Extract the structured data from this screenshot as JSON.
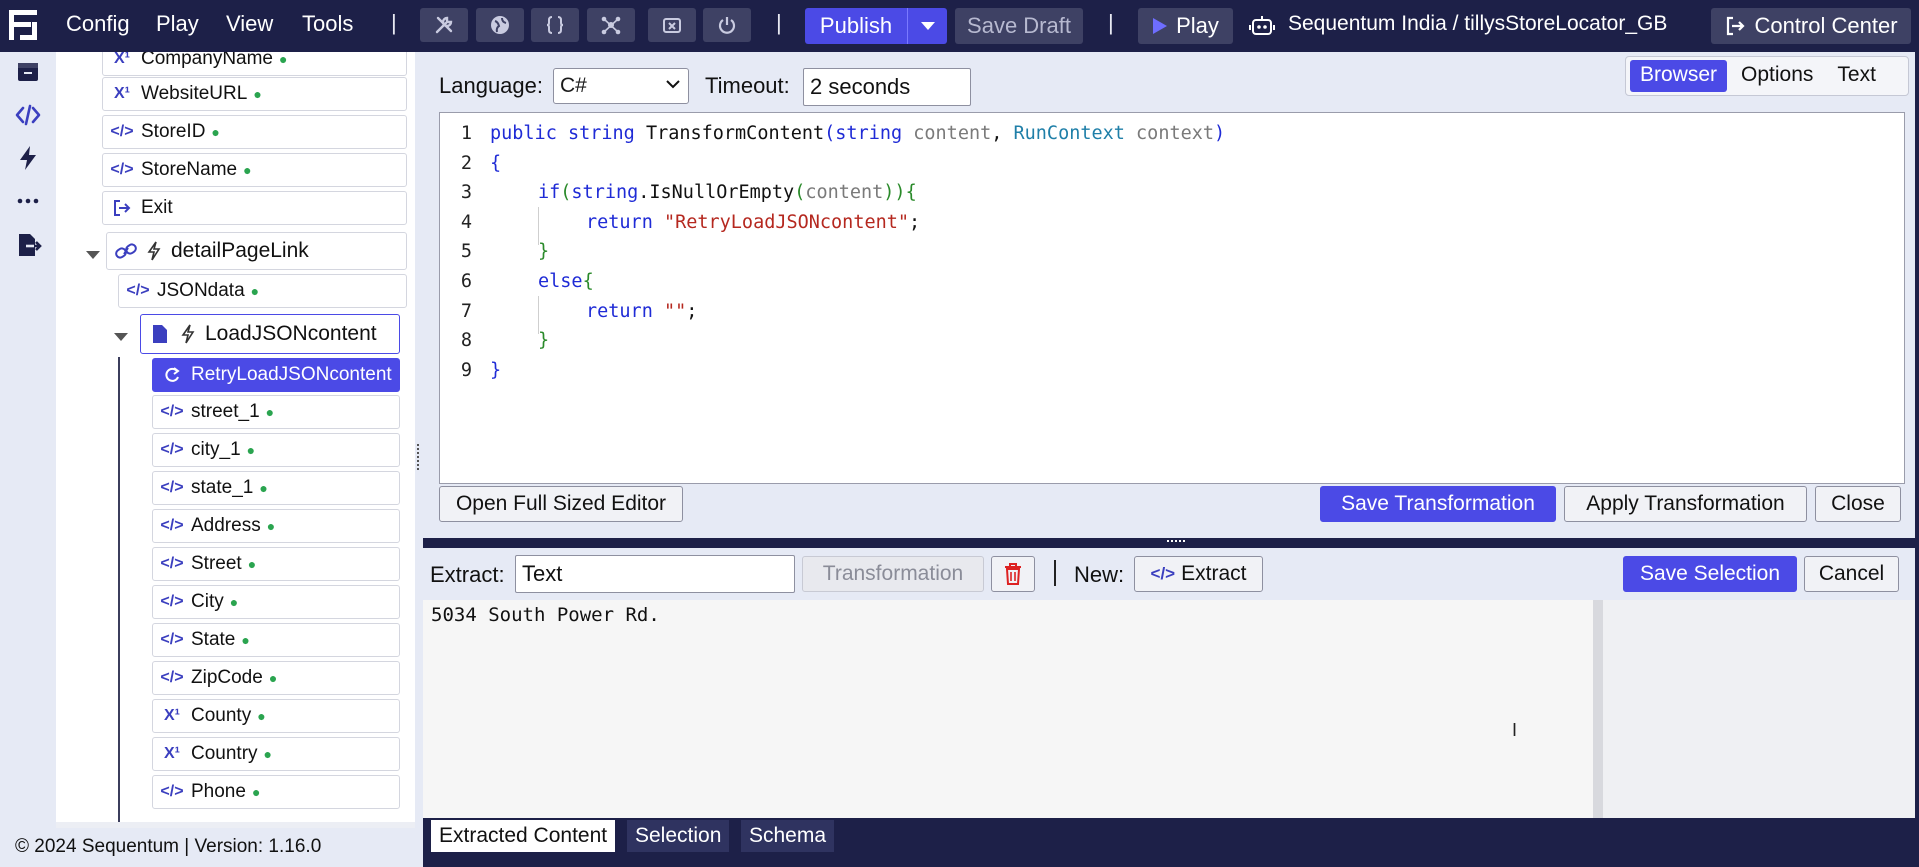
{
  "topbar": {
    "menus": [
      "Config",
      "Play",
      "View",
      "Tools"
    ],
    "publish_label": "Publish",
    "save_draft_label": "Save Draft",
    "play_label": "Play",
    "project_path": "Sequentum India / tillysStoreLocator_GB",
    "control_center_label": "Control Center"
  },
  "tree": {
    "nodes": [
      {
        "label": "CompanyName",
        "icon": "superscript-x-icon"
      },
      {
        "label": "WebsiteURL",
        "icon": "superscript-x-icon"
      },
      {
        "label": "StoreID",
        "icon": "code-icon"
      },
      {
        "label": "StoreName",
        "icon": "code-icon"
      },
      {
        "label": "Exit",
        "icon": "exit-icon"
      },
      {
        "label": "detailPageLink",
        "icon": "link-icon"
      },
      {
        "label": "JSONdata",
        "icon": "code-icon"
      },
      {
        "label": "LoadJSONcontent",
        "icon": "file-icon"
      },
      {
        "label": "RetryLoadJSONcontent",
        "icon": "retry-icon"
      },
      {
        "label": "street_1",
        "icon": "code-icon"
      },
      {
        "label": "city_1",
        "icon": "code-icon"
      },
      {
        "label": "state_1",
        "icon": "code-icon"
      },
      {
        "label": "Address",
        "icon": "code-icon"
      },
      {
        "label": "Street",
        "icon": "code-icon"
      },
      {
        "label": "City",
        "icon": "code-icon"
      },
      {
        "label": "State",
        "icon": "code-icon"
      },
      {
        "label": "ZipCode",
        "icon": "code-icon"
      },
      {
        "label": "County",
        "icon": "superscript-x-icon"
      },
      {
        "label": "Country",
        "icon": "superscript-x-icon"
      },
      {
        "label": "Phone",
        "icon": "code-icon"
      }
    ]
  },
  "footer": {
    "text": "© 2024 Sequentum | Version: 1.16.0"
  },
  "editor": {
    "language_label": "Language:",
    "language_value": "C#",
    "timeout_label": "Timeout:",
    "timeout_value": "2 seconds",
    "tabs": [
      "Browser",
      "Options",
      "Text"
    ],
    "active_tab": "Browser",
    "line_numbers": [
      "1",
      "2",
      "3",
      "4",
      "5",
      "6",
      "7",
      "8",
      "9"
    ],
    "code": {
      "l1_kw1": "public",
      "l1_kw2": "string",
      "l1_fn": "TransformContent",
      "l1_kw3": "string",
      "l1_p1": "content",
      "l1_ty": "RunContext",
      "l1_p2": "context",
      "l2": "{",
      "l3_kw": "if",
      "l3_kw2": "string",
      "l3_call": ".IsNullOrEmpty",
      "l3_p": "content",
      "l4_kw": "return",
      "l4_str": "\"RetryLoadJSONcontent\"",
      "l5": "}",
      "l6_kw": "else",
      "l7_kw": "return",
      "l7_str": "\"\"",
      "l8": "}",
      "l9": "}"
    },
    "open_full_label": "Open Full Sized Editor",
    "save_transformation_label": "Save Transformation",
    "apply_transformation_label": "Apply Transformation",
    "close_label": "Close"
  },
  "extract": {
    "extract_label": "Extract:",
    "extract_value": "Text",
    "transformation_label": "Transformation",
    "new_label": "New:",
    "new_extract_label": "Extract",
    "save_selection_label": "Save Selection",
    "cancel_label": "Cancel",
    "output_text": "5034 South Power Rd."
  },
  "bottom_tabs": [
    "Extracted Content",
    "Selection",
    "Schema"
  ],
  "colors": {
    "navy": "#1d2048",
    "accent": "#4b4ae6",
    "panel": "#e6eaf5",
    "dot": "#2aa44f"
  }
}
